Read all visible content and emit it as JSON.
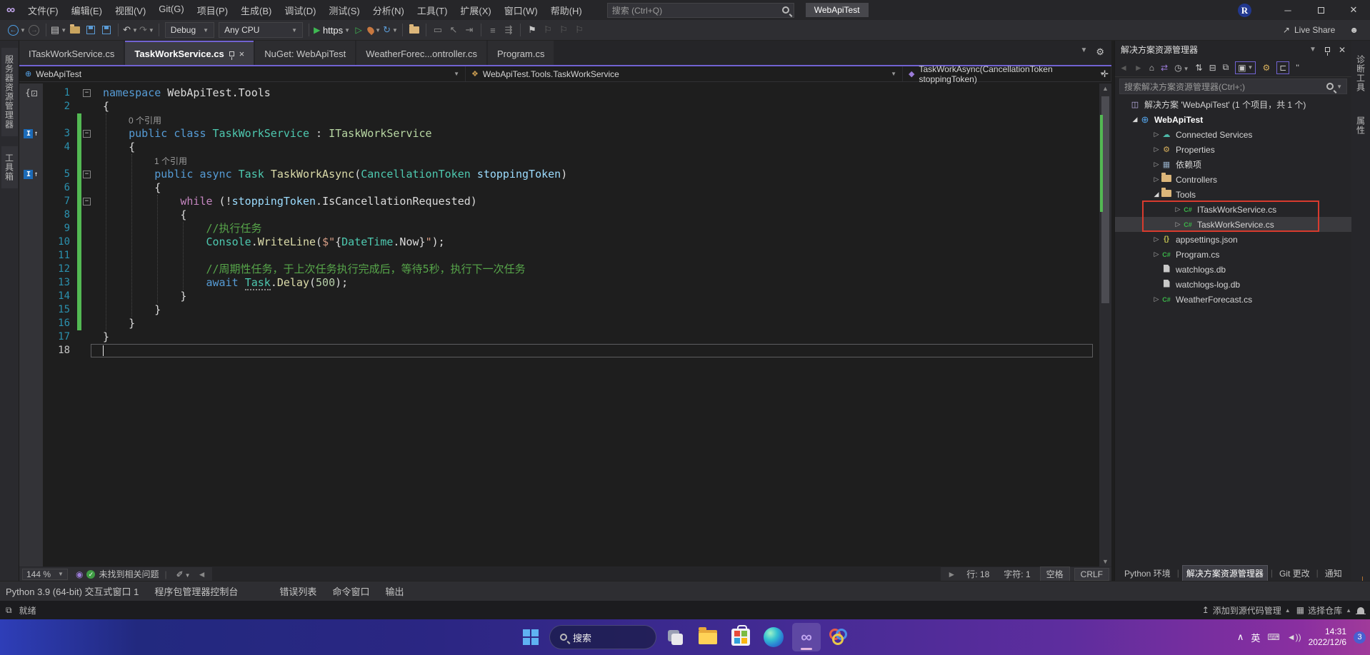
{
  "colors": {
    "accent_purple": "#7163d2",
    "change_bar_green": "#53b953",
    "annotation_red": "#d83b2e",
    "keyword_blue": "#569cd6",
    "type_teal": "#4ec9b0",
    "comment_green": "#57a64a"
  },
  "title_bar": {
    "menus": [
      "文件(F)",
      "编辑(E)",
      "视图(V)",
      "Git(G)",
      "项目(P)",
      "生成(B)",
      "调试(D)",
      "测试(S)",
      "分析(N)",
      "工具(T)",
      "扩展(X)",
      "窗口(W)",
      "帮助(H)"
    ],
    "search_placeholder": "搜索 (Ctrl+Q)",
    "solution_badge": "WebApiTest",
    "resharper_badge": "R",
    "minimize": "─",
    "maximize": "",
    "close": "✕"
  },
  "toolbar": {
    "config": "Debug",
    "platform": "Any CPU",
    "run_profile": "https",
    "live_share": "Live Share"
  },
  "left_strip": [
    "服务器资源管理器",
    "工具箱"
  ],
  "right_strip": [
    "诊断工具",
    "属性"
  ],
  "editor_tabs": [
    {
      "label": "ITaskWorkService.cs",
      "active": false
    },
    {
      "label": "TaskWorkService.cs",
      "active": true
    },
    {
      "label": "NuGet: WebApiTest",
      "active": false
    },
    {
      "label": "WeatherForec...ontroller.cs",
      "active": false
    },
    {
      "label": "Program.cs",
      "active": false
    }
  ],
  "breadcrumb": {
    "project": "WebApiTest",
    "type": "WebApiTest.Tools.TaskWorkService",
    "member": "TaskWorkAsync(CancellationToken stoppingToken)"
  },
  "editor": {
    "rows": [
      {
        "t": "code",
        "n": "1",
        "fold": true,
        "glyph": "brace",
        "tokens": [
          [
            "kw",
            "namespace"
          ],
          [
            "pln",
            " WebApiTest.Tools"
          ]
        ]
      },
      {
        "t": "code",
        "n": "2",
        "tokens": [
          [
            "pln",
            "{"
          ]
        ]
      },
      {
        "t": "lens",
        "ind": 1,
        "chg": true,
        "text": "0 个引用"
      },
      {
        "t": "code",
        "n": "3",
        "chg": true,
        "fold": true,
        "glyph": "impl",
        "tokens": [
          [
            "pln",
            "    "
          ],
          [
            "kw",
            "public"
          ],
          [
            "pln",
            " "
          ],
          [
            "kw",
            "class"
          ],
          [
            "pln",
            " "
          ],
          [
            "type",
            "TaskWorkService"
          ],
          [
            "pln",
            " : "
          ],
          [
            "iface",
            "ITaskWorkService"
          ]
        ]
      },
      {
        "t": "code",
        "n": "4",
        "chg": true,
        "tokens": [
          [
            "pln",
            "    {"
          ]
        ]
      },
      {
        "t": "lens",
        "ind": 2,
        "chg": true,
        "text": "1 个引用"
      },
      {
        "t": "code",
        "n": "5",
        "chg": true,
        "fold": true,
        "glyph": "impl",
        "tokens": [
          [
            "pln",
            "        "
          ],
          [
            "kw",
            "public"
          ],
          [
            "pln",
            " "
          ],
          [
            "kw",
            "async"
          ],
          [
            "pln",
            " "
          ],
          [
            "type",
            "Task"
          ],
          [
            "pln",
            " "
          ],
          [
            "method",
            "TaskWorkAsync"
          ],
          [
            "pln",
            "("
          ],
          [
            "type",
            "CancellationToken"
          ],
          [
            "pln",
            " "
          ],
          [
            "param",
            "stoppingToken"
          ],
          [
            "pln",
            ")"
          ]
        ]
      },
      {
        "t": "code",
        "n": "6",
        "chg": true,
        "tokens": [
          [
            "pln",
            "        {"
          ]
        ]
      },
      {
        "t": "code",
        "n": "7",
        "chg": true,
        "fold": true,
        "tokens": [
          [
            "pln",
            "            "
          ],
          [
            "ctl",
            "while"
          ],
          [
            "pln",
            " (!"
          ],
          [
            "param",
            "stoppingToken"
          ],
          [
            "pln",
            "."
          ],
          [
            "pln",
            "IsCancellationRequested"
          ],
          [
            "pln",
            ")"
          ]
        ]
      },
      {
        "t": "code",
        "n": "8",
        "chg": true,
        "tokens": [
          [
            "pln",
            "            {"
          ]
        ]
      },
      {
        "t": "code",
        "n": "9",
        "chg": true,
        "tokens": [
          [
            "pln",
            "                "
          ],
          [
            "com",
            "//执行任务"
          ]
        ]
      },
      {
        "t": "code",
        "n": "10",
        "chg": true,
        "tokens": [
          [
            "pln",
            "                "
          ],
          [
            "type",
            "Console"
          ],
          [
            "pln",
            "."
          ],
          [
            "method",
            "WriteLine"
          ],
          [
            "pln",
            "("
          ],
          [
            "str",
            "$\""
          ],
          [
            "pln",
            "{"
          ],
          [
            "type",
            "DateTime"
          ],
          [
            "pln",
            ".Now"
          ],
          [
            "pln",
            "}"
          ],
          [
            "str",
            "\""
          ],
          [
            "pln",
            ");"
          ]
        ]
      },
      {
        "t": "code",
        "n": "11",
        "chg": true,
        "tokens": []
      },
      {
        "t": "code",
        "n": "12",
        "chg": true,
        "tokens": [
          [
            "pln",
            "                "
          ],
          [
            "com",
            "//周期性任务，于上次任务执行完成后，等待5秒，执行下一次任务"
          ]
        ]
      },
      {
        "t": "code",
        "n": "13",
        "chg": true,
        "tokens": [
          [
            "pln",
            "                "
          ],
          [
            "kw",
            "await"
          ],
          [
            "pln",
            " "
          ],
          [
            "typeu",
            "Task"
          ],
          [
            "pln",
            "."
          ],
          [
            "method",
            "Delay"
          ],
          [
            "pln",
            "("
          ],
          [
            "num",
            "500"
          ],
          [
            "pln",
            ");"
          ]
        ]
      },
      {
        "t": "code",
        "n": "14",
        "chg": true,
        "tokens": [
          [
            "pln",
            "            }"
          ]
        ]
      },
      {
        "t": "code",
        "n": "15",
        "chg": true,
        "tokens": [
          [
            "pln",
            "        }"
          ]
        ]
      },
      {
        "t": "code",
        "n": "16",
        "chg": true,
        "tokens": [
          [
            "pln",
            "    }"
          ]
        ]
      },
      {
        "t": "code",
        "n": "17",
        "tokens": [
          [
            "pln",
            "}"
          ]
        ]
      },
      {
        "t": "code",
        "n": "18",
        "current": true,
        "tokens": []
      }
    ]
  },
  "editor_status": {
    "zoom": "144 %",
    "health": "未找到相关问题",
    "line": "行: 18",
    "column": "字符: 1",
    "spaces": "空格",
    "eol": "CRLF"
  },
  "bottom_tabs": [
    "Python 3.9 (64-bit) 交互式窗口 1",
    "程序包管理器控制台",
    "错误列表",
    "命令窗口",
    "输出"
  ],
  "solution_explorer": {
    "title": "解决方案资源管理器",
    "search_placeholder": "搜索解决方案资源管理器(Ctrl+;)",
    "tree": [
      {
        "icon": "solution",
        "lvl": 0,
        "label": "解决方案 'WebApiTest' (1 个项目，共 1 个)"
      },
      {
        "icon": "project",
        "lvl": 0,
        "exp": "open",
        "bold": true,
        "label": "WebApiTest"
      },
      {
        "icon": "cloud",
        "lvl": 1,
        "exp": "closed",
        "label": "Connected Services"
      },
      {
        "icon": "props",
        "lvl": 1,
        "exp": "closed",
        "label": "Properties"
      },
      {
        "icon": "deps",
        "lvl": 1,
        "exp": "closed",
        "label": "依赖项"
      },
      {
        "icon": "folder",
        "lvl": 1,
        "exp": "closed",
        "label": "Controllers"
      },
      {
        "icon": "folder",
        "lvl": 1,
        "exp": "open",
        "label": "Tools"
      },
      {
        "icon": "csharp",
        "lvl": 2,
        "exp": "closed",
        "label": "ITaskWorkService.cs"
      },
      {
        "icon": "csharp",
        "lvl": 2,
        "exp": "closed",
        "sel": true,
        "label": "TaskWorkService.cs"
      },
      {
        "icon": "json",
        "lvl": 1,
        "exp": "closed",
        "label": "appsettings.json"
      },
      {
        "icon": "csharp",
        "lvl": 1,
        "exp": "closed",
        "label": "Program.cs"
      },
      {
        "icon": "file",
        "lvl": 1,
        "label": "watchlogs.db"
      },
      {
        "icon": "file",
        "lvl": 1,
        "label": "watchlogs-log.db"
      },
      {
        "icon": "csharp",
        "lvl": 1,
        "exp": "closed",
        "label": "WeatherForecast.cs"
      }
    ],
    "bottom_tabs": [
      "Python 环境",
      "解决方案资源管理器",
      "Git 更改",
      "通知"
    ],
    "active_bottom_tab": "解决方案资源管理器"
  },
  "status_bar": {
    "ready": "就绪",
    "add_source_control": "添加到源代码管理",
    "select_repo": "选择仓库"
  },
  "taskbar": {
    "search": "搜索",
    "tray": {
      "chevron": "∧",
      "lang": "英",
      "time": "14:31",
      "date": "2022/12/6",
      "badge": "3"
    }
  }
}
